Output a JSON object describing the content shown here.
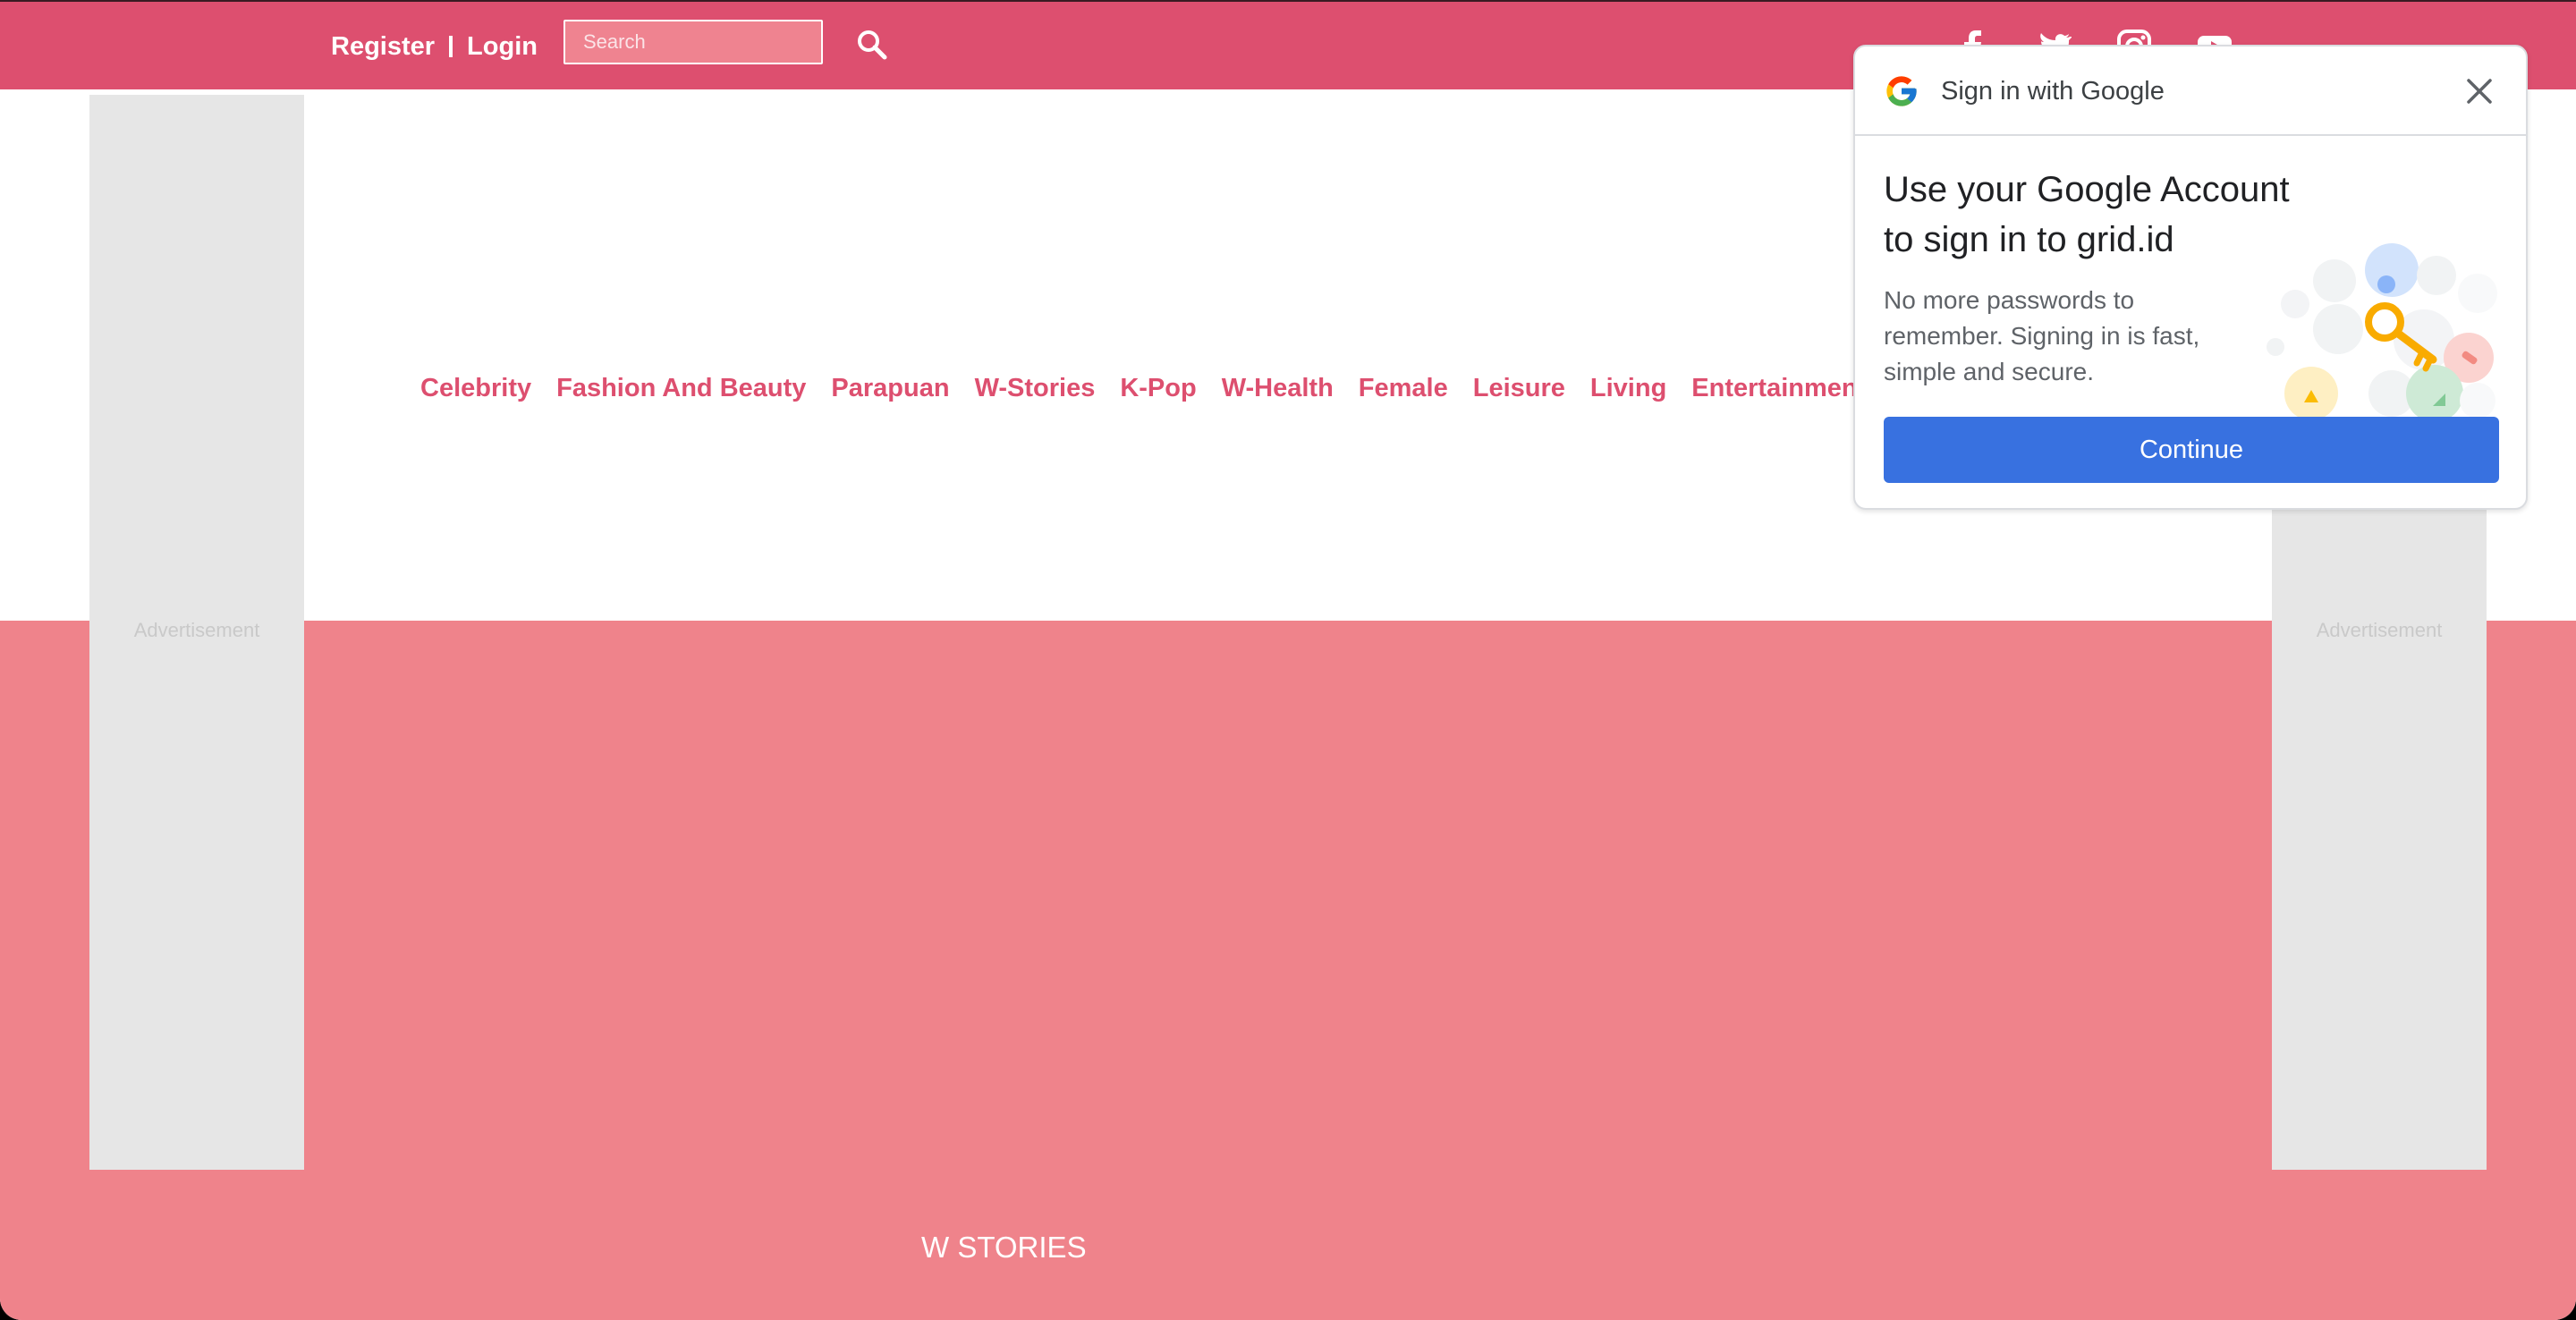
{
  "topbar": {
    "register_label": "Register",
    "login_label": "Login",
    "search_placeholder": "Search",
    "social_icons": [
      "facebook-icon",
      "twitter-icon",
      "instagram-icon",
      "youtube-icon"
    ]
  },
  "nav": {
    "items": [
      "Celebrity",
      "Fashion And Beauty",
      "Parapuan",
      "W-Stories",
      "K-Pop",
      "W-Health",
      "Female",
      "Leisure",
      "Living",
      "Entertainment"
    ]
  },
  "ads": {
    "left_label": "Advertisement",
    "right_label": "Advertisement"
  },
  "section": {
    "title": "W STORIES"
  },
  "google_signin": {
    "header_title": "Sign in with Google",
    "heading": "Use your Google Account to sign in to grid.id",
    "description": "No more passwords to remember. Signing in is fast, simple and secure.",
    "continue_label": "Continue"
  },
  "colors": {
    "brand_pink": "#dd4f6f",
    "band_pink": "#ef838b",
    "google_blue": "#3871e0"
  }
}
